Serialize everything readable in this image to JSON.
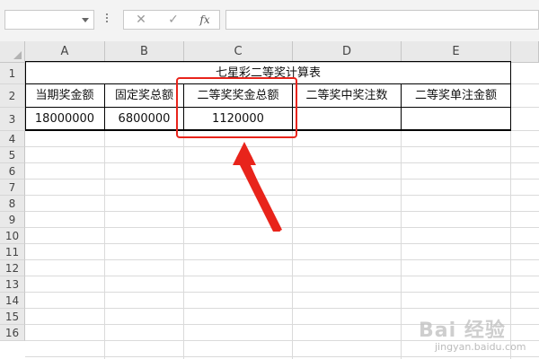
{
  "formula_bar": {
    "name_box_value": "",
    "cancel_glyph": "✕",
    "enter_glyph": "✓",
    "fx_label": "fx",
    "formula_value": ""
  },
  "columns": [
    "A",
    "B",
    "C",
    "D",
    "E"
  ],
  "rows": [
    "1",
    "2",
    "3",
    "4",
    "5",
    "6",
    "7",
    "8",
    "9",
    "10",
    "11",
    "12",
    "13",
    "14",
    "15",
    "16"
  ],
  "sheet": {
    "title": "七星彩二等奖计算表",
    "headers": [
      "当期奖金额",
      "固定奖总额",
      "二等奖奖金总额",
      "二等奖中奖注数",
      "二等奖单注金额"
    ],
    "values": [
      "18000000",
      "6800000",
      "1120000",
      "",
      ""
    ]
  },
  "colors": {
    "highlight": "#e8241b",
    "grid": "#dadada",
    "header_bg": "#e9e9e9"
  },
  "watermark": {
    "main": "Bai 经验",
    "sub": "jingyan.baidu.com"
  }
}
